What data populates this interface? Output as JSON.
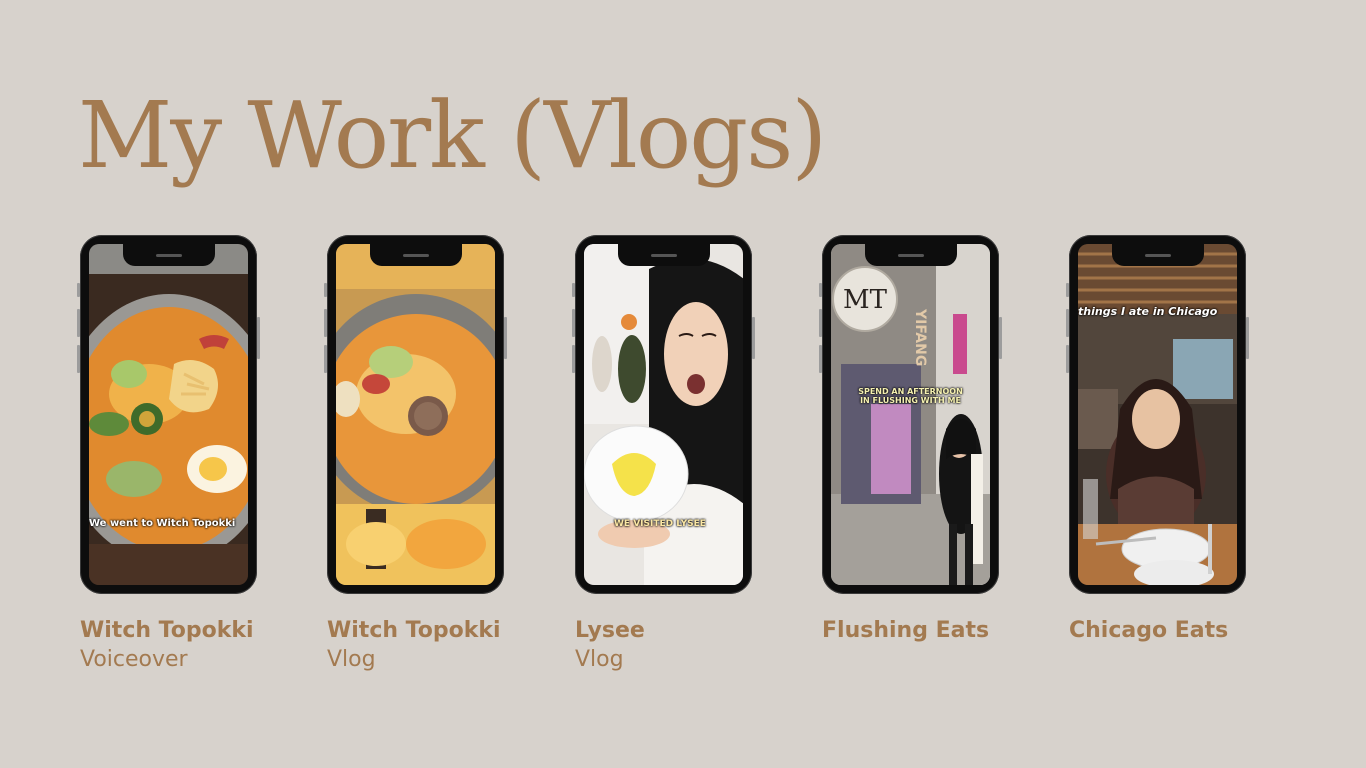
{
  "page": {
    "title": "My Work (Vlogs)",
    "background_color": "#d7d2cc",
    "accent_color": "#a37a50"
  },
  "videos": [
    {
      "title": "Witch Topokki",
      "subtitle": "Voiceover",
      "overlay_text": "We went to Witch Topokki"
    },
    {
      "title": "Witch Topokki",
      "subtitle": "Vlog",
      "overlay_text": ""
    },
    {
      "title": "Lysee",
      "subtitle": "Vlog",
      "overlay_text": "WE VISITED LYSEE"
    },
    {
      "title": "Flushing Eats",
      "subtitle": "",
      "overlay_text": "SPEND AN AFTERNOON IN FLUSHING WITH ME",
      "sign_text": "YIFANG",
      "logo_text": "MT"
    },
    {
      "title": "Chicago Eats",
      "subtitle": "",
      "overlay_text": "things I ate in Chicago"
    }
  ]
}
